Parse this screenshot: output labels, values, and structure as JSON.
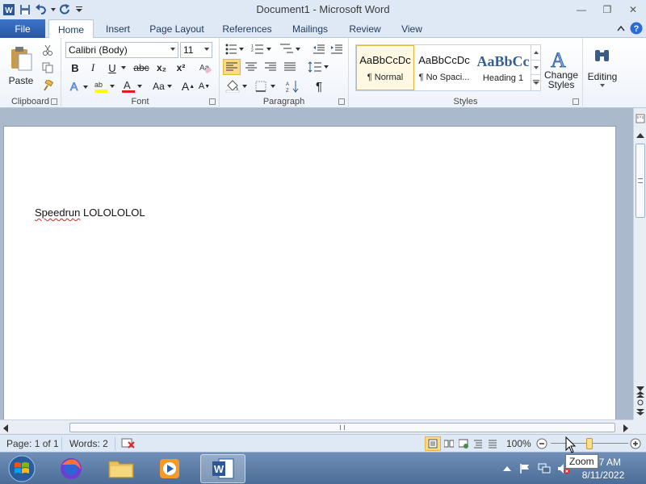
{
  "window": {
    "title": "Document1  -  Microsoft Word",
    "minimize_glyph": "—",
    "maximize_glyph": "❐",
    "close_glyph": "✕"
  },
  "tabs": {
    "file": "File",
    "items": [
      "Home",
      "Insert",
      "Page Layout",
      "References",
      "Mailings",
      "Review",
      "View"
    ],
    "active": "Home"
  },
  "ribbon": {
    "clipboard": {
      "label": "Clipboard",
      "paste": "Paste"
    },
    "font": {
      "label": "Font",
      "font_name": "Calibri (Body)",
      "font_size": "11",
      "bold": "B",
      "italic": "I",
      "underline": "U",
      "strikethrough": "abc",
      "subscript": "x₂",
      "superscript": "x²",
      "grow": "A",
      "shrink": "A",
      "change_case": "Aa"
    },
    "paragraph": {
      "label": "Paragraph",
      "show_marks": "¶"
    },
    "styles": {
      "label": "Styles",
      "items": [
        {
          "sample": "AaBbCcDc",
          "name": "¶ Normal"
        },
        {
          "sample": "AaBbCcDc",
          "name": "¶ No Spaci..."
        },
        {
          "sample": "AaBbCc",
          "name": "Heading 1"
        }
      ],
      "change_styles": [
        "Change",
        "Styles"
      ]
    },
    "editing": {
      "label": "Editing"
    }
  },
  "document": {
    "word_misspelled": "Speedrun",
    "text_rest": " LOLOLOLOL"
  },
  "status": {
    "page": "Page: 1 of 1",
    "words": "Words: 2",
    "zoom": "100%",
    "zoom_level_percent": 100
  },
  "taskbar": {
    "time": "7:07 AM",
    "date": "8/11/2022",
    "tooltip": "Zoom"
  },
  "colors": {
    "accent": "#2b579a",
    "file_tab": "#2a57a6",
    "selected_style_border": "#e3b63b",
    "spelling_error": "#dd2222"
  }
}
